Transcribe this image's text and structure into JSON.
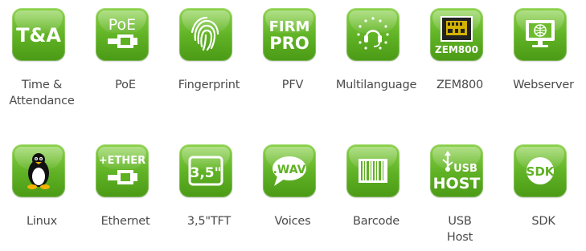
{
  "features": {
    "row1": [
      {
        "icon": "time-attendance-icon",
        "text": "T&A",
        "label_lines": [
          "Time &",
          "Attendance"
        ]
      },
      {
        "icon": "poe-icon",
        "text": "PoE",
        "label_lines": [
          "PoE"
        ]
      },
      {
        "icon": "fingerprint-icon",
        "text": "",
        "label_lines": [
          "Fingerprint"
        ]
      },
      {
        "icon": "firmware-pro-icon",
        "text_lines": [
          "FIRM",
          "PRO"
        ],
        "label_lines": [
          "PFV"
        ]
      },
      {
        "icon": "multilanguage-headset-icon",
        "text": "",
        "label_lines": [
          "Multilanguage"
        ]
      },
      {
        "icon": "zem800-chip-icon",
        "text": "ZEM800",
        "label_lines": [
          "ZEM800"
        ]
      },
      {
        "icon": "webserver-monitor-icon",
        "text": "",
        "label_lines": [
          "Webserver"
        ]
      }
    ],
    "row2": [
      {
        "icon": "linux-penguin-icon",
        "text": "",
        "label_lines": [
          "Linux"
        ]
      },
      {
        "icon": "ethernet-icon",
        "text": "+ETHER",
        "label_lines": [
          "Ethernet"
        ]
      },
      {
        "icon": "tft-screen-icon",
        "text": "3,5\"",
        "label_lines": [
          "3,5\"TFT"
        ]
      },
      {
        "icon": "voices-bubble-icon",
        "text": ".WAV",
        "label_lines": [
          "Voices"
        ]
      },
      {
        "icon": "barcode-icon",
        "text": "",
        "label_lines": [
          "Barcode"
        ]
      },
      {
        "icon": "usb-host-icon",
        "text_lines": [
          "USB",
          "HOST"
        ],
        "label_lines": [
          "USB",
          "Host"
        ]
      },
      {
        "icon": "sdk-icon",
        "text": "SDK",
        "label_lines": [
          "SDK"
        ]
      }
    ]
  },
  "colors": {
    "tile": "#5fb124",
    "label": "#4a4a4a"
  }
}
